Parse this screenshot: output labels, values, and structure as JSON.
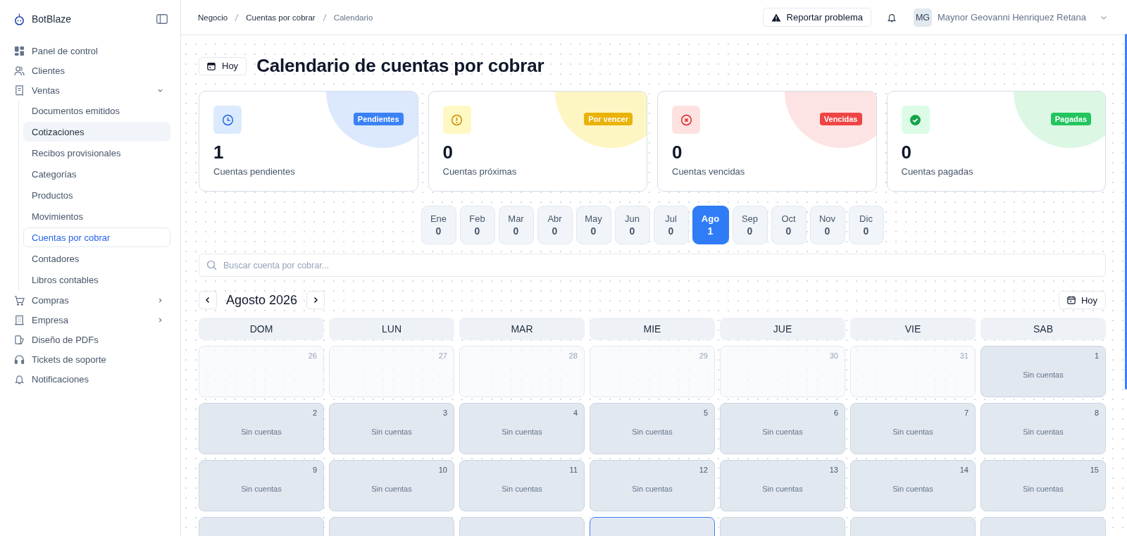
{
  "sidebar": {
    "brand": "BotBlaze",
    "items": [
      {
        "label": "Panel de control",
        "selected": false
      },
      {
        "label": "Clientes",
        "selected": false
      },
      {
        "label": "Ventas",
        "selected": false,
        "expanded": true,
        "children": [
          {
            "label": "Documentos emitidos",
            "selected": false,
            "highlighted": false
          },
          {
            "label": "Cotizaciones",
            "selected": false,
            "highlighted": true
          },
          {
            "label": "Recibos provisionales",
            "selected": false,
            "highlighted": false
          },
          {
            "label": "Categorías",
            "selected": false,
            "highlighted": false
          },
          {
            "label": "Productos",
            "selected": false,
            "highlighted": false
          },
          {
            "label": "Movimientos",
            "selected": false,
            "highlighted": false
          },
          {
            "label": "Cuentas por cobrar",
            "selected": true,
            "highlighted": false
          },
          {
            "label": "Contadores",
            "selected": false,
            "highlighted": false
          },
          {
            "label": "Libros contables",
            "selected": false,
            "highlighted": false
          }
        ]
      },
      {
        "label": "Compras",
        "selected": false,
        "expanded": false
      },
      {
        "label": "Empresa",
        "selected": false,
        "expanded": false
      },
      {
        "label": "Diseño de PDFs",
        "selected": false
      },
      {
        "label": "Tickets de soporte",
        "selected": false
      },
      {
        "label": "Notificaciones",
        "selected": false
      }
    ]
  },
  "header": {
    "breadcrumbs": [
      "Negocio",
      "Cuentas por cobrar",
      "Calendario"
    ],
    "report_button": "Reportar problema",
    "avatar": "MG",
    "user_name": "Maynor Geovanni Henriquez Retana"
  },
  "page": {
    "today_button": "Hoy",
    "title": "Calendario de cuentas por cobrar"
  },
  "stats": [
    {
      "kind": "pending",
      "badge": "Pendientes",
      "value": "1",
      "label": "Cuentas pendientes"
    },
    {
      "kind": "due",
      "badge": "Por vencer",
      "value": "0",
      "label": "Cuentas próximas"
    },
    {
      "kind": "overdue",
      "badge": "Vencidas",
      "value": "0",
      "label": "Cuentas vencidas"
    },
    {
      "kind": "paid",
      "badge": "Pagadas",
      "value": "0",
      "label": "Cuentas pagadas"
    }
  ],
  "months": [
    {
      "label": "Ene",
      "count": "0",
      "selected": false
    },
    {
      "label": "Feb",
      "count": "0",
      "selected": false
    },
    {
      "label": "Mar",
      "count": "0",
      "selected": false
    },
    {
      "label": "Abr",
      "count": "0",
      "selected": false
    },
    {
      "label": "May",
      "count": "0",
      "selected": false
    },
    {
      "label": "Jun",
      "count": "0",
      "selected": false
    },
    {
      "label": "Jul",
      "count": "0",
      "selected": false
    },
    {
      "label": "Ago",
      "count": "1",
      "selected": true
    },
    {
      "label": "Sep",
      "count": "0",
      "selected": false
    },
    {
      "label": "Oct",
      "count": "0",
      "selected": false
    },
    {
      "label": "Nov",
      "count": "0",
      "selected": false
    },
    {
      "label": "Dic",
      "count": "0",
      "selected": false
    }
  ],
  "search": {
    "placeholder": "Buscar cuenta por cobrar..."
  },
  "calendar": {
    "title": "Agosto 2026",
    "today_button": "Hoy",
    "weekdays": [
      "DOM",
      "LUN",
      "MAR",
      "MIE",
      "JUE",
      "VIE",
      "SAB"
    ],
    "weeks": [
      [
        {
          "day": "26",
          "outside": true
        },
        {
          "day": "27",
          "outside": true
        },
        {
          "day": "28",
          "outside": true
        },
        {
          "day": "29",
          "outside": true
        },
        {
          "day": "30",
          "outside": true
        },
        {
          "day": "31",
          "outside": true
        },
        {
          "day": "1",
          "outside": false,
          "text": "Sin cuentas"
        }
      ],
      [
        {
          "day": "2",
          "outside": false,
          "text": "Sin cuentas"
        },
        {
          "day": "3",
          "outside": false,
          "text": "Sin cuentas"
        },
        {
          "day": "4",
          "outside": false,
          "text": "Sin cuentas"
        },
        {
          "day": "5",
          "outside": false,
          "text": "Sin cuentas"
        },
        {
          "day": "6",
          "outside": false,
          "text": "Sin cuentas"
        },
        {
          "day": "7",
          "outside": false,
          "text": "Sin cuentas"
        },
        {
          "day": "8",
          "outside": false,
          "text": "Sin cuentas"
        }
      ],
      [
        {
          "day": "9",
          "outside": false,
          "text": "Sin cuentas"
        },
        {
          "day": "10",
          "outside": false,
          "text": "Sin cuentas"
        },
        {
          "day": "11",
          "outside": false,
          "text": "Sin cuentas"
        },
        {
          "day": "12",
          "outside": false,
          "text": "Sin cuentas"
        },
        {
          "day": "13",
          "outside": false,
          "text": "Sin cuentas"
        },
        {
          "day": "14",
          "outside": false,
          "text": "Sin cuentas"
        },
        {
          "day": "15",
          "outside": false,
          "text": "Sin cuentas"
        }
      ]
    ],
    "partial_week": [
      {
        "today": false
      },
      {
        "today": false
      },
      {
        "today": false
      },
      {
        "today": true
      },
      {
        "today": false
      },
      {
        "today": false
      },
      {
        "today": false
      }
    ]
  }
}
